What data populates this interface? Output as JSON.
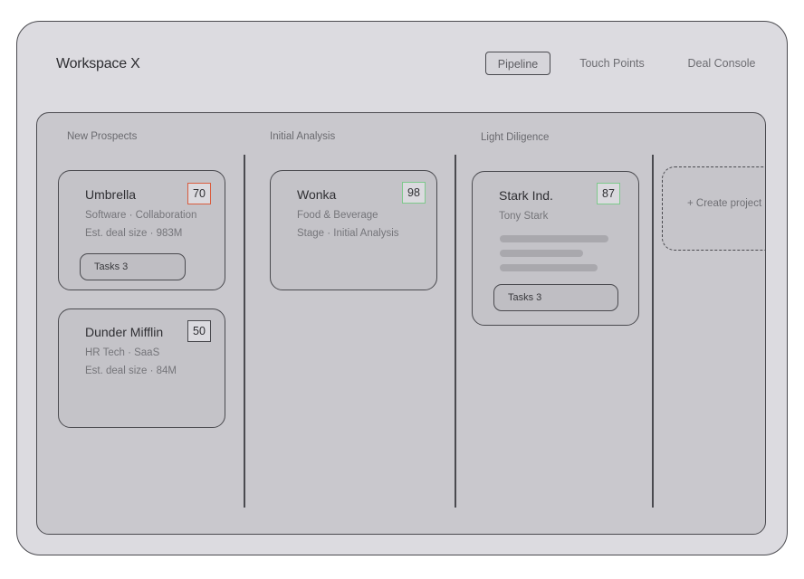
{
  "app": {
    "title": "Workspace X"
  },
  "nav": [
    {
      "label": "Pipeline",
      "active": true
    },
    {
      "label": "Touch Points",
      "active": false
    },
    {
      "label": "Deal Console",
      "active": false
    }
  ],
  "columns": [
    {
      "title": "New Prospects",
      "cards": [
        {
          "name": "Umbrella",
          "score": "70",
          "score_status": "red",
          "line1": "Software · Collaboration",
          "line2": "Est. deal size · 983M",
          "tasks_label": "Tasks 3"
        },
        {
          "name": "Dunder Mifflin",
          "score": "50",
          "score_status": "neutral",
          "line1": "HR Tech · SaaS",
          "line2": "Est. deal size · 84M"
        }
      ]
    },
    {
      "title": "Initial Analysis",
      "cards": [
        {
          "name": "Wonka",
          "score": "98",
          "score_status": "green",
          "line1": "Food & Beverage",
          "line2": "Stage · Initial Analysis"
        }
      ]
    },
    {
      "title": "Light Diligence",
      "cards": [
        {
          "name": "Stark Ind.",
          "score": "87",
          "score_status": "green",
          "line1": "Tony Stark",
          "tasks_label": "Tasks 3"
        }
      ]
    }
  ],
  "create_project": {
    "label": "+ Create project"
  },
  "colors": {
    "score_red": "#d95c3e",
    "score_green": "#7ec98c",
    "outline": "#4a4a4f"
  }
}
